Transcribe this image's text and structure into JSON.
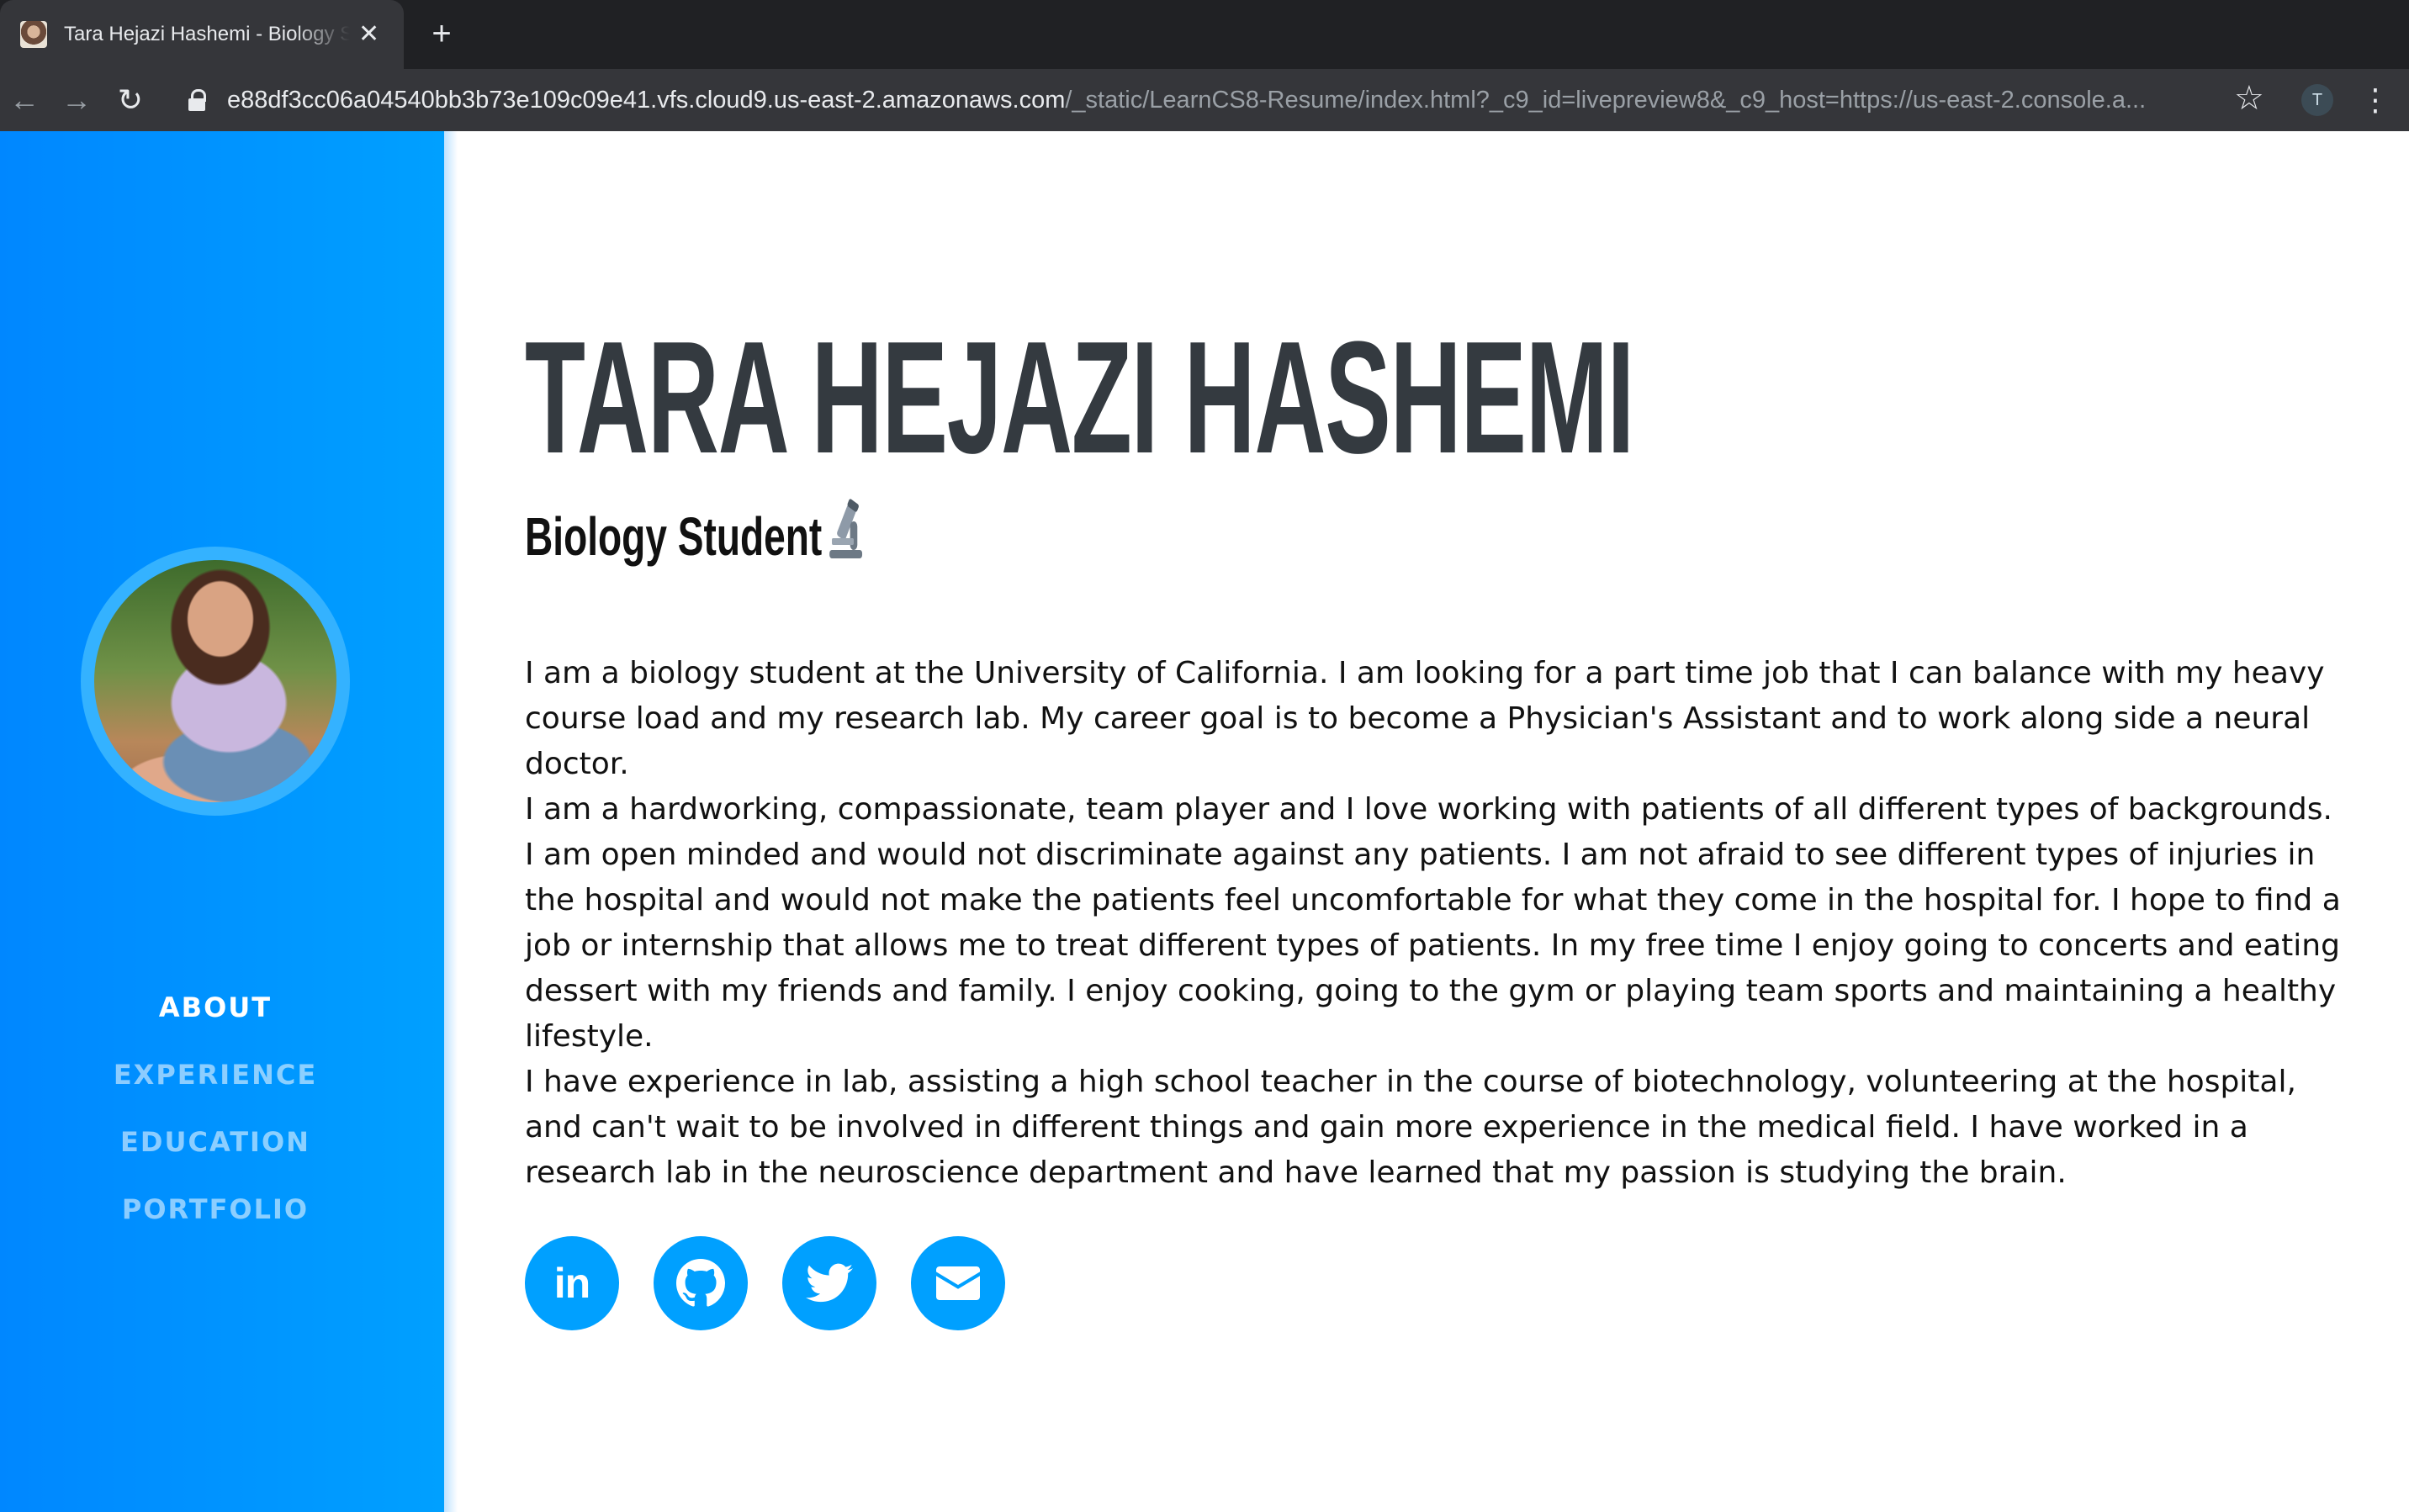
{
  "browser": {
    "tab_title": "Tara Hejazi Hashemi - Biology Student",
    "tab_close": "✕",
    "new_tab": "+",
    "url_host": "e88df3cc06a04540bb3b73e109c09e41.vfs.cloud9.us-east-2.amazonaws.com",
    "url_rest": "/_static/LearnCS8-Resume/index.html?_c9_id=livepreview8&_c9_host=https://us-east-2.console.a...",
    "back": "←",
    "forward": "→",
    "reload": "↻",
    "star": "☆",
    "profile_initial": "T",
    "menu": "⋮"
  },
  "sidebar": {
    "nav": [
      {
        "label": "ABOUT",
        "active": true
      },
      {
        "label": "EXPERIENCE",
        "active": false
      },
      {
        "label": "EDUCATION",
        "active": false
      },
      {
        "label": "PORTFOLIO",
        "active": false
      }
    ]
  },
  "main": {
    "name": "TARA HEJAZI HASHEMI",
    "subtitle": "Biology Student",
    "paragraphs": [
      "I am a biology student at the University of California. I am looking for a part time job that I can balance with my heavy course load and my research lab. My career goal is to become a Physician's Assistant and to work along side a neural doctor.",
      "I am a hardworking, compassionate, team player and I love working with patients of all different types of backgrounds. I am open minded and would not discriminate against any patients. I am not afraid to see different types of injuries in the hospital and would not make the patients feel uncomfortable for what they come in the hospital for. I hope to find a job or internship that allows me to treat different types of patients. In my free time I enjoy going to concerts and eating dessert with my friends and family. I enjoy cooking, going to the gym or playing team sports and maintaining a healthy lifestyle.",
      "I have experience in lab, assisting a high school teacher in the course of biotechnology, volunteering at the hospital, and can't wait to be involved in different things and gain more experience in the medical field. I have worked in a research lab in the neuroscience department and have learned that my passion is studying the brain."
    ],
    "social_icons": [
      "linkedin-icon",
      "github-icon",
      "twitter-icon",
      "email-icon"
    ],
    "linkedin_text": "in"
  },
  "colors": {
    "sidebar_start": "#0087ff",
    "sidebar_end": "#00a0ff",
    "heading": "#343a40",
    "accent": "#00a0ff"
  }
}
